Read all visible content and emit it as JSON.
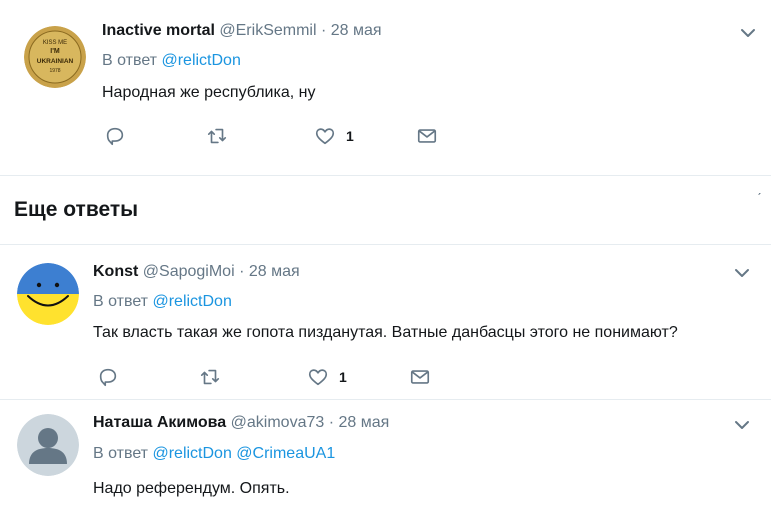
{
  "tweets": [
    {
      "fullname": "Inactive mortal",
      "handle": "@ErikSemmil",
      "separator": "·",
      "date": "28 мая",
      "reply_prefix": "В ответ",
      "mentions": [
        "@relictDon"
      ],
      "text": "Народная же республика, ну",
      "likes": "1",
      "avatar_text": [
        "KISS ME",
        "I'M",
        "UKRAINIAN",
        "1978"
      ]
    },
    {
      "fullname": "Konst",
      "handle": "@SapogiMoi",
      "separator": "·",
      "date": "28 мая",
      "reply_prefix": "В ответ",
      "mentions": [
        "@relictDon"
      ],
      "text": "Так власть такая же гопота пизданутая. Ватные данбасцы этого не понимают?",
      "likes": "1"
    },
    {
      "fullname": "Наташа Акимова",
      "handle": "@akimova73",
      "separator": "·",
      "date": "28 мая",
      "reply_prefix": "В ответ",
      "mentions": [
        "@relictDon",
        "@CrimeaUA1"
      ],
      "text": "Надо референдум. Опять."
    }
  ],
  "more_replies_title": "Еще ответы",
  "colors": {
    "link": "#1b95e0",
    "secondary_text": "#657786",
    "primary_text": "#14171a",
    "divider": "#e6ecf0",
    "flag_blue": "#3d7fd1",
    "flag_yellow": "#ffe22e"
  },
  "icons": [
    "reply-icon",
    "retweet-icon",
    "like-icon",
    "direct-message-icon",
    "chevron-down-icon"
  ]
}
